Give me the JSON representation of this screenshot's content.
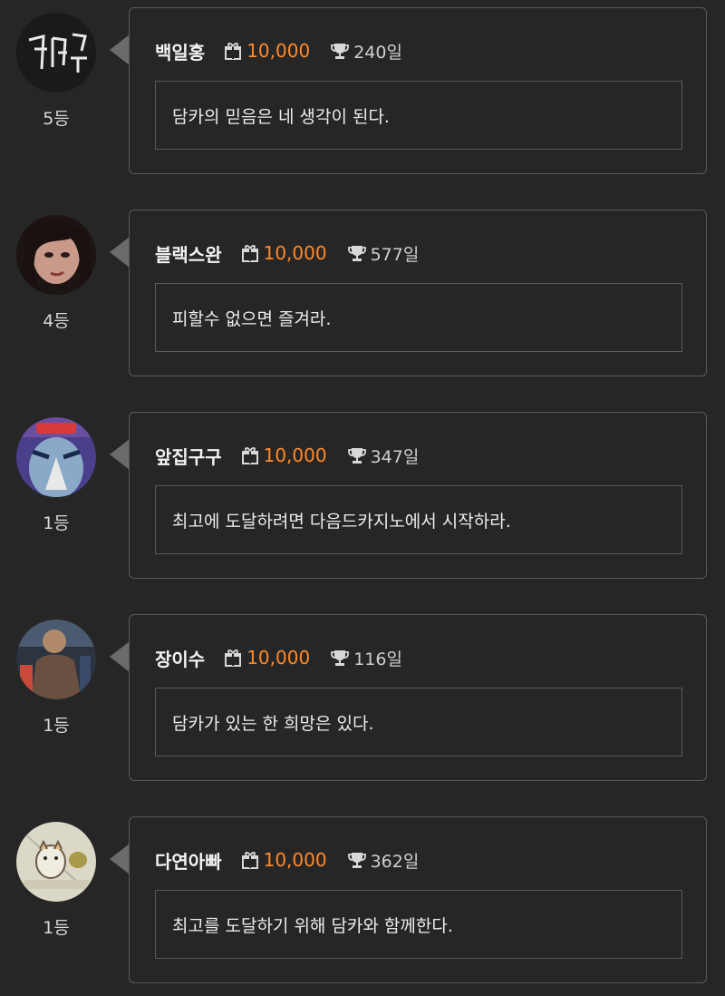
{
  "icons": {
    "gift": "gift-icon",
    "trophy": "trophy-icon"
  },
  "colors": {
    "background": "#262626",
    "border": "#5a5a5a",
    "amount": "#ff8a2b"
  },
  "entries": [
    {
      "nickname": "백일홍",
      "amount": "10,000",
      "days": "240일",
      "message": "담카의 믿음은 네 생각이 된다.",
      "rank": "5등"
    },
    {
      "nickname": "블랙스완",
      "amount": "10,000",
      "days": "577일",
      "message": "피할수 없으면 즐겨라.",
      "rank": "4등"
    },
    {
      "nickname": "앞집구구",
      "amount": "10,000",
      "days": "347일",
      "message": "최고에 도달하려면 다음드카지노에서 시작하라.",
      "rank": "1등"
    },
    {
      "nickname": "장이수",
      "amount": "10,000",
      "days": "116일",
      "message": "담카가 있는 한 희망은 있다.",
      "rank": "1등"
    },
    {
      "nickname": "다연아빠",
      "amount": "10,000",
      "days": "362일",
      "message": "최고를 도달하기 위해 담카와 함께한다.",
      "rank": "1등"
    }
  ]
}
